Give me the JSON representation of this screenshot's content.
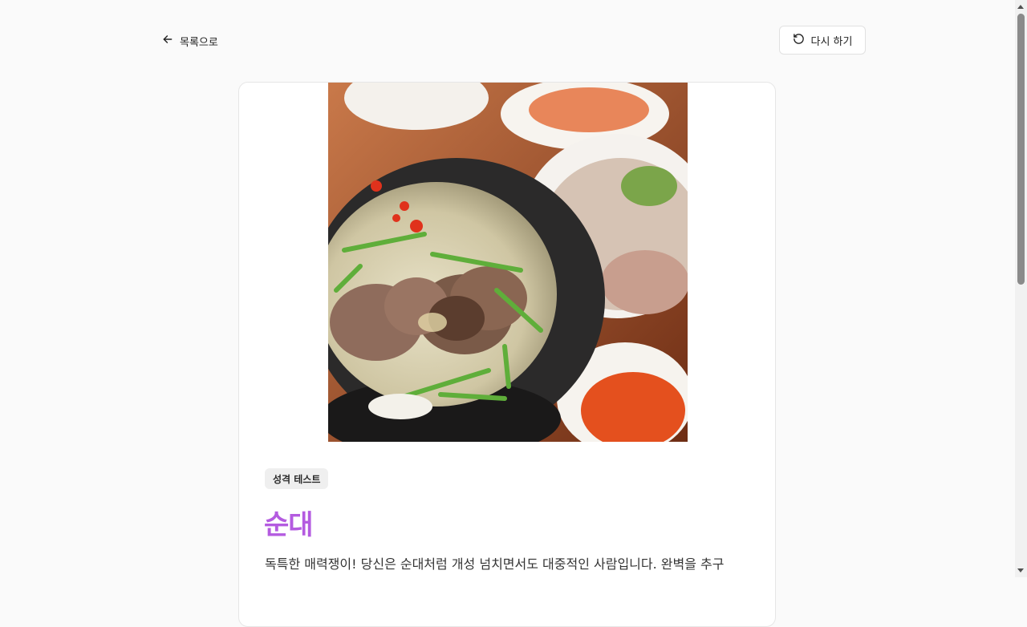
{
  "nav": {
    "back_label": "목록으로",
    "back_icon": "arrow-left-icon",
    "retry_label": "다시 하기",
    "retry_icon": "rotate-ccw-icon"
  },
  "result": {
    "tag": "성격 테스트",
    "title": "순대",
    "description": "독특한 매력쟁이! 당신은 순대처럼 개성 넘치면서도 대중적인 사람입니다. 완벽을 추구",
    "image_alt": "순대국"
  },
  "colors": {
    "accent": "#b45be0",
    "background": "#fafafa"
  }
}
